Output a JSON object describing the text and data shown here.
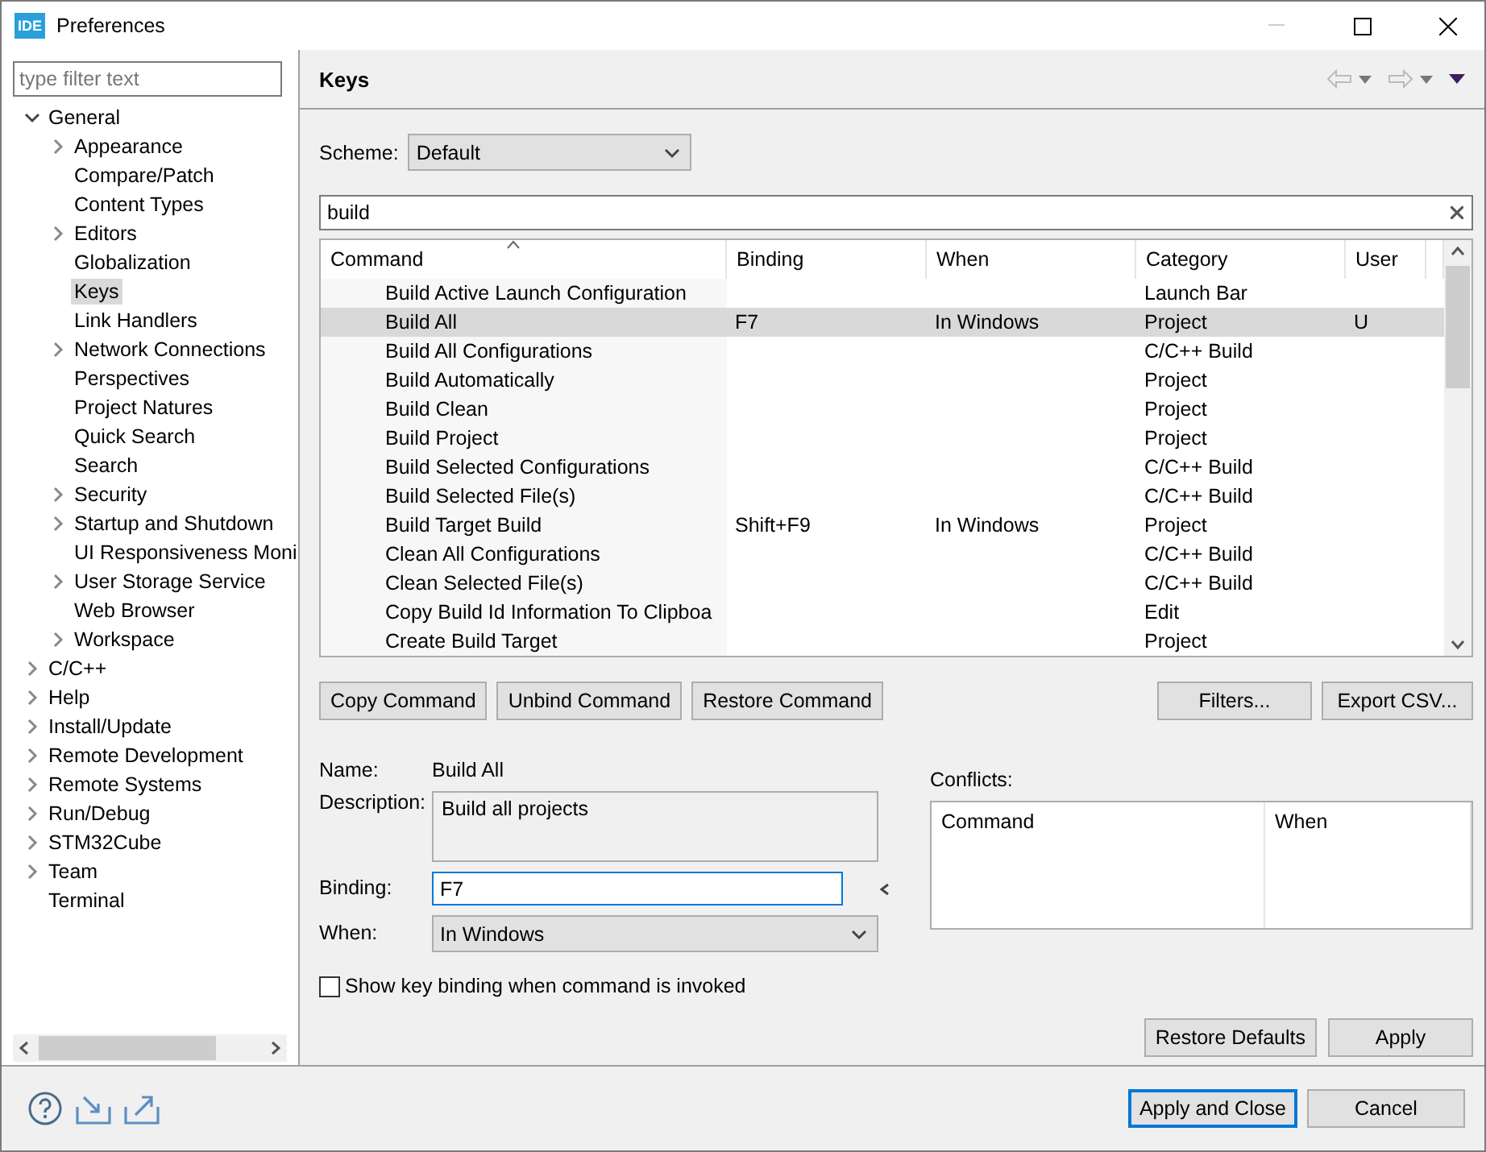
{
  "window": {
    "title": "Preferences",
    "app_badge": "IDE"
  },
  "sidebar": {
    "filter": {
      "placeholder": "type filter text"
    },
    "items": [
      {
        "label": "General",
        "kind": "folder",
        "expanded": true,
        "selected": false,
        "children": [
          {
            "label": "Appearance",
            "kind": "folder",
            "expanded": false,
            "selected": false
          },
          {
            "label": "Compare/Patch",
            "kind": "leaf",
            "selected": false
          },
          {
            "label": "Content Types",
            "kind": "leaf",
            "selected": false
          },
          {
            "label": "Editors",
            "kind": "folder",
            "expanded": false,
            "selected": false
          },
          {
            "label": "Globalization",
            "kind": "leaf",
            "selected": false
          },
          {
            "label": "Keys",
            "kind": "leaf",
            "selected": true
          },
          {
            "label": "Link Handlers",
            "kind": "leaf",
            "selected": false
          },
          {
            "label": "Network Connections",
            "kind": "folder",
            "expanded": false,
            "selected": false
          },
          {
            "label": "Perspectives",
            "kind": "leaf",
            "selected": false
          },
          {
            "label": "Project Natures",
            "kind": "leaf",
            "selected": false
          },
          {
            "label": "Quick Search",
            "kind": "leaf",
            "selected": false
          },
          {
            "label": "Search",
            "kind": "leaf",
            "selected": false
          },
          {
            "label": "Security",
            "kind": "folder",
            "expanded": false,
            "selected": false
          },
          {
            "label": "Startup and Shutdown",
            "kind": "folder",
            "expanded": false,
            "selected": false
          },
          {
            "label": "UI Responsiveness Moni",
            "kind": "leaf",
            "selected": false
          },
          {
            "label": "User Storage Service",
            "kind": "folder",
            "expanded": false,
            "selected": false
          },
          {
            "label": "Web Browser",
            "kind": "leaf",
            "selected": false
          },
          {
            "label": "Workspace",
            "kind": "folder",
            "expanded": false,
            "selected": false
          }
        ]
      },
      {
        "label": "C/C++",
        "kind": "folder",
        "expanded": false,
        "selected": false
      },
      {
        "label": "Help",
        "kind": "folder",
        "expanded": false,
        "selected": false
      },
      {
        "label": "Install/Update",
        "kind": "folder",
        "expanded": false,
        "selected": false
      },
      {
        "label": "Remote Development",
        "kind": "folder",
        "expanded": false,
        "selected": false
      },
      {
        "label": "Remote Systems",
        "kind": "folder",
        "expanded": false,
        "selected": false
      },
      {
        "label": "Run/Debug",
        "kind": "folder",
        "expanded": false,
        "selected": false
      },
      {
        "label": "STM32Cube",
        "kind": "folder",
        "expanded": false,
        "selected": false
      },
      {
        "label": "Team",
        "kind": "folder",
        "expanded": false,
        "selected": false
      },
      {
        "label": "Terminal",
        "kind": "leaf",
        "selected": false
      }
    ]
  },
  "page": {
    "title": "Keys",
    "scheme": {
      "label": "Scheme:",
      "value": "Default"
    },
    "search": {
      "value": "build"
    },
    "table": {
      "columns": [
        "Command",
        "Binding",
        "When",
        "Category",
        "User"
      ],
      "rows": [
        {
          "command": "Build Active Launch Configuration",
          "binding": "",
          "when": "",
          "category": "Launch Bar",
          "user": "",
          "selected": false
        },
        {
          "command": "Build All",
          "binding": "F7",
          "when": "In Windows",
          "category": "Project",
          "user": "U",
          "selected": true
        },
        {
          "command": "Build All Configurations",
          "binding": "",
          "when": "",
          "category": "C/C++ Build",
          "user": "",
          "selected": false
        },
        {
          "command": "Build Automatically",
          "binding": "",
          "when": "",
          "category": "Project",
          "user": "",
          "selected": false
        },
        {
          "command": "Build Clean",
          "binding": "",
          "when": "",
          "category": "Project",
          "user": "",
          "selected": false
        },
        {
          "command": "Build Project",
          "binding": "",
          "when": "",
          "category": "Project",
          "user": "",
          "selected": false
        },
        {
          "command": "Build Selected Configurations",
          "binding": "",
          "when": "",
          "category": "C/C++ Build",
          "user": "",
          "selected": false
        },
        {
          "command": "Build Selected File(s)",
          "binding": "",
          "when": "",
          "category": "C/C++ Build",
          "user": "",
          "selected": false
        },
        {
          "command": "Build Target Build",
          "binding": "Shift+F9",
          "when": "In Windows",
          "category": "Project",
          "user": "",
          "selected": false
        },
        {
          "command": "Clean All Configurations",
          "binding": "",
          "when": "",
          "category": "C/C++ Build",
          "user": "",
          "selected": false
        },
        {
          "command": "Clean Selected File(s)",
          "binding": "",
          "when": "",
          "category": "C/C++ Build",
          "user": "",
          "selected": false
        },
        {
          "command": "Copy Build Id Information To Clipboa",
          "binding": "",
          "when": "",
          "category": "Edit",
          "user": "",
          "selected": false
        },
        {
          "command": "Create Build Target",
          "binding": "",
          "when": "",
          "category": "Project",
          "user": "",
          "selected": false
        }
      ]
    },
    "left_buttons": [
      "Copy Command",
      "Unbind Command",
      "Restore Command"
    ],
    "right_buttons": [
      "Filters...",
      "Export CSV..."
    ],
    "details": {
      "name_label": "Name:",
      "name": "Build All",
      "description_label": "Description:",
      "description": "Build all projects",
      "binding_label": "Binding:",
      "binding": "F7",
      "when_label": "When:",
      "when": "In Windows"
    },
    "conflicts": {
      "label": "Conflicts:",
      "columns": [
        "Command",
        "When"
      ]
    },
    "show_binding": {
      "label": "Show key binding when command is invoked",
      "checked": false
    },
    "page_buttons": [
      "Restore Defaults",
      "Apply"
    ]
  },
  "footer": {
    "buttons": [
      {
        "label": "Apply and Close",
        "default": true
      },
      {
        "label": "Cancel",
        "default": false
      }
    ]
  }
}
